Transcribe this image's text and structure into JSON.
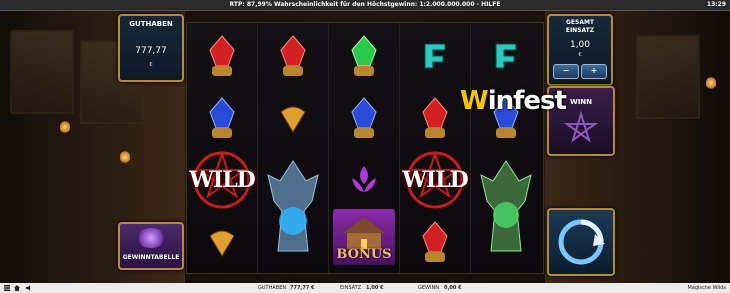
{
  "topbar": {
    "rtp_text": "RTP: 87,99% Wahrscheinlichkeit für den Höchstgewinn: 1:2.000.000.000 - HILFE",
    "clock": "13:29"
  },
  "balance_panel": {
    "title": "GUTHABEN",
    "value": "777,77",
    "currency": "€"
  },
  "bet_panel": {
    "title_line1": "GESAMT",
    "title_line2": "EINSATZ",
    "value": "1,00",
    "currency": "€",
    "minus": "−",
    "plus": "+"
  },
  "paytable_button": {
    "label": "GEWINNTABELLE"
  },
  "win_panel": {
    "label": "WINN"
  },
  "logo": {
    "first": "W",
    "rest": "infest"
  },
  "reels": {
    "wild_text": "WILD",
    "bonus_text": "BONUS"
  },
  "bottombar": {
    "balance_label": "GUTHABEN",
    "balance_value": "777,77 €",
    "bet_label": "EINSATZ",
    "bet_value": "1,00 €",
    "win_label": "GEWINN",
    "win_value": "0,00 €",
    "game_title": "Magische Wilds"
  },
  "colors": {
    "accent_gold": "#b38a3e",
    "panel_blue": "#16283a",
    "wild_red": "#c41e1e"
  }
}
